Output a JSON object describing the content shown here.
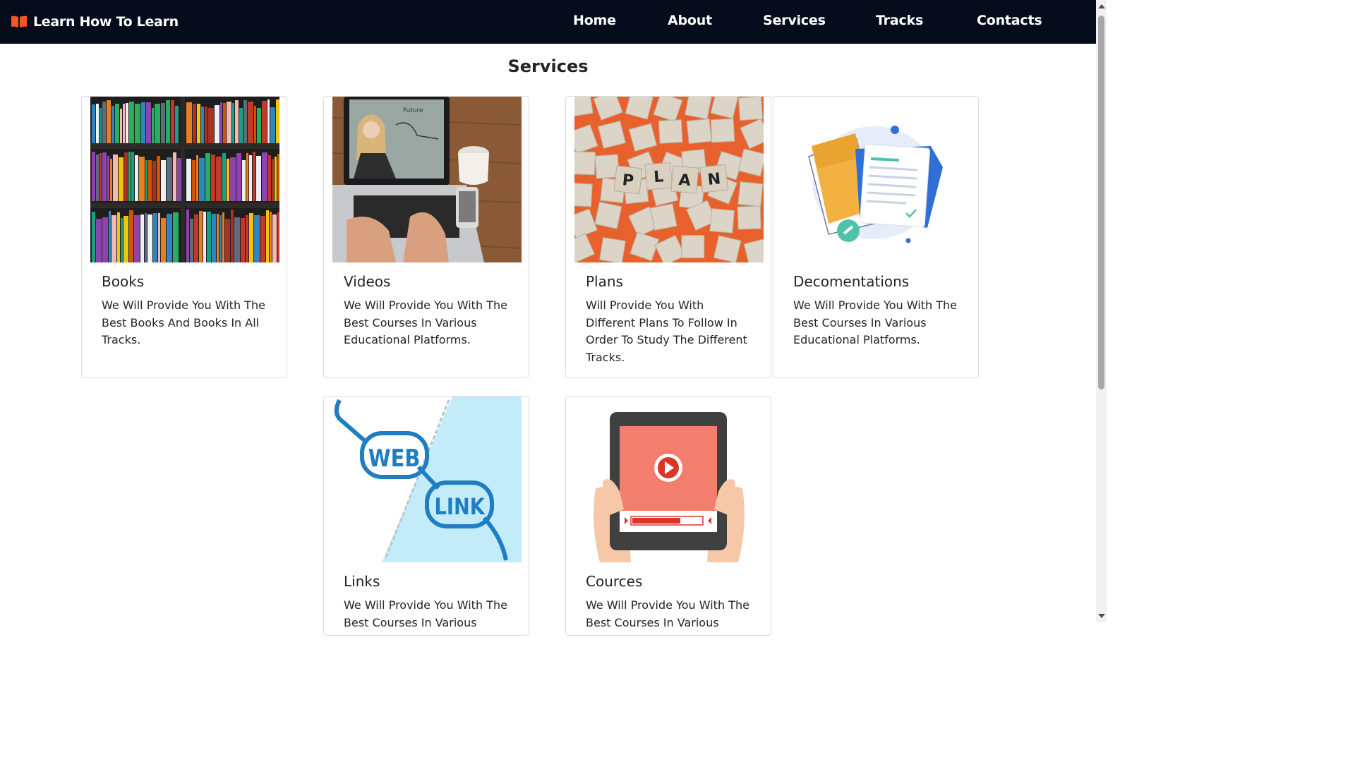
{
  "brand": {
    "name": "Learn How To Learn",
    "icon": "book-icon",
    "icon_color": "#f05a22"
  },
  "nav": {
    "links": [
      {
        "label": "Home"
      },
      {
        "label": "About"
      },
      {
        "label": "Services"
      },
      {
        "label": "Tracks"
      },
      {
        "label": "Contacts"
      }
    ]
  },
  "page_title": "Services",
  "cards": [
    {
      "title": "Books",
      "text": "We Will Provide You With The Best Books And Books In All Tracks.",
      "image": "bookshelf-photo"
    },
    {
      "title": "Videos",
      "text": "We Will Provide You With The Best Courses In Various Educational Platforms.",
      "image": "laptop-video-photo"
    },
    {
      "title": "Plans",
      "text": "Will Provide You With Different Plans To Follow In Order To Study The Different Tracks.",
      "image": "plan-tiles-photo"
    },
    {
      "title": "Decomentations",
      "text": "We Will Provide You With The Best Courses In Various Educational Platforms.",
      "image": "documents-illustration"
    },
    {
      "title": "Links",
      "text": "We Will Provide You With The Best Courses In Various Educational Platforms.",
      "image": "web-link-illustration"
    },
    {
      "title": "Cources",
      "text": "We Will Provide You With The Best Courses In Various Educational Platforms.",
      "image": "tablet-video-illustration"
    }
  ],
  "images": {
    "plan_tiles": [
      "P",
      "L",
      "A",
      "N"
    ],
    "link_words": [
      "WEB",
      "LINK"
    ]
  },
  "colors": {
    "navbar_bg": "#060c1c",
    "accent": "#f05a22",
    "link_blue": "#1f7dc1",
    "link_bg": "#c3ecf8",
    "video_red": "#f47e6e"
  }
}
